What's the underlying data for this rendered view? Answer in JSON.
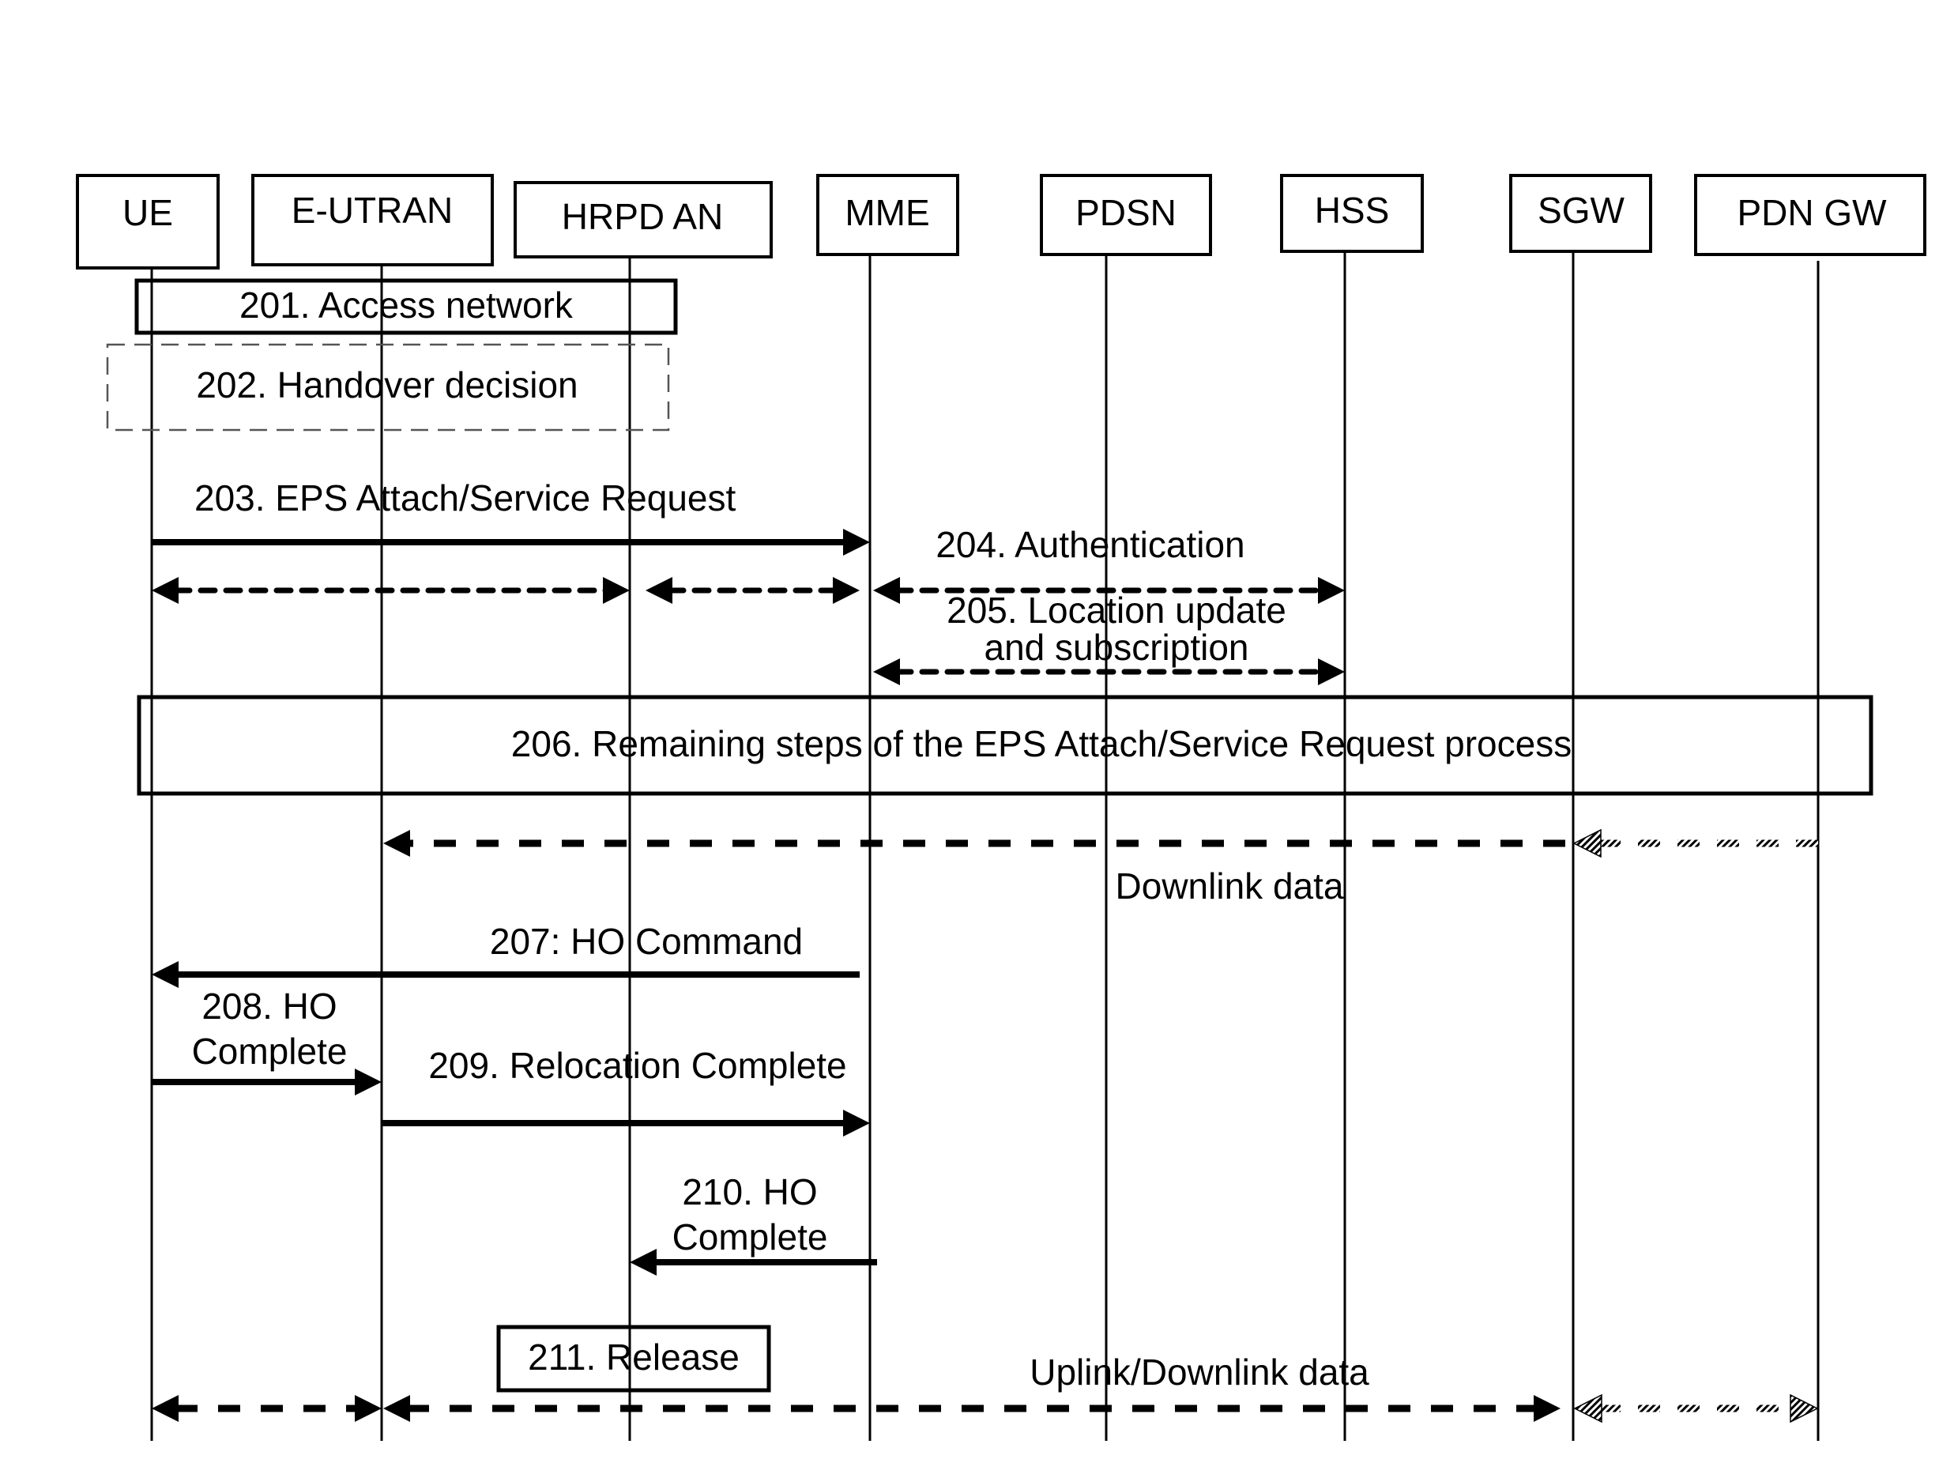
{
  "diagram": {
    "type": "sequence-diagram",
    "entities": [
      {
        "id": "ue",
        "label": "UE"
      },
      {
        "id": "eutran",
        "label": "E-UTRAN"
      },
      {
        "id": "hrpd",
        "label": "HRPD AN"
      },
      {
        "id": "mme",
        "label": "MME"
      },
      {
        "id": "pdsn",
        "label": "PDSN"
      },
      {
        "id": "hss",
        "label": "HSS"
      },
      {
        "id": "sgw",
        "label": "SGW"
      },
      {
        "id": "pdngw",
        "label": "PDN GW"
      }
    ],
    "notes": [
      {
        "id": "201",
        "text": "201. Access network",
        "style": "solid"
      },
      {
        "id": "202",
        "text": "202. Handover decision",
        "style": "dashed"
      },
      {
        "id": "206",
        "text": "206. Remaining steps of the EPS Attach/Service Request process",
        "style": "solid"
      },
      {
        "id": "211",
        "text": "211. Release",
        "style": "solid"
      }
    ],
    "messages": [
      {
        "id": "203",
        "label": [
          "203. EPS Attach/Service Request"
        ],
        "from": "ue",
        "to": "mme",
        "style": "solid"
      },
      {
        "id": "access-a",
        "label": [],
        "from": "ue",
        "to": "hrpd",
        "style": "dashed-bidirectional"
      },
      {
        "id": "access-b",
        "label": [],
        "from": "hrpd",
        "to": "mme",
        "style": "dashed-bidirectional"
      },
      {
        "id": "204",
        "label": [
          "204. Authentication"
        ],
        "from": "mme",
        "to": "hss",
        "style": "dashed-bidirectional"
      },
      {
        "id": "205",
        "label": [
          "205. Location update",
          "and subscription"
        ],
        "from": "mme",
        "to": "hss",
        "style": "dashed-bidirectional"
      },
      {
        "id": "dl-a",
        "label": [
          "Downlink data"
        ],
        "from": "sgw",
        "to": "eutran",
        "style": "thick-dashed"
      },
      {
        "id": "dl-b",
        "label": [],
        "from": "pdngw",
        "to": "sgw",
        "style": "hatched"
      },
      {
        "id": "207",
        "label": [
          "207: HO Command"
        ],
        "from": "mme",
        "to": "ue",
        "style": "solid"
      },
      {
        "id": "208",
        "label": [
          "208. HO",
          "Complete"
        ],
        "from": "ue",
        "to": "eutran",
        "style": "solid"
      },
      {
        "id": "209",
        "label": [
          "209. Relocation Complete"
        ],
        "from": "eutran",
        "to": "mme",
        "style": "solid"
      },
      {
        "id": "210",
        "label": [
          "210. HO",
          "Complete"
        ],
        "from": "mme",
        "to": "hrpd",
        "style": "solid"
      },
      {
        "id": "ul-a",
        "label": [],
        "from": "ue",
        "to": "eutran",
        "style": "thick-dashed-bidirectional"
      },
      {
        "id": "ul-b",
        "label": [
          "Uplink/Downlink data"
        ],
        "from": "eutran",
        "to": "sgw",
        "style": "thick-dashed-bidirectional"
      },
      {
        "id": "ul-c",
        "label": [],
        "from": "sgw",
        "to": "pdngw",
        "style": "hatched-bidirectional"
      }
    ]
  }
}
